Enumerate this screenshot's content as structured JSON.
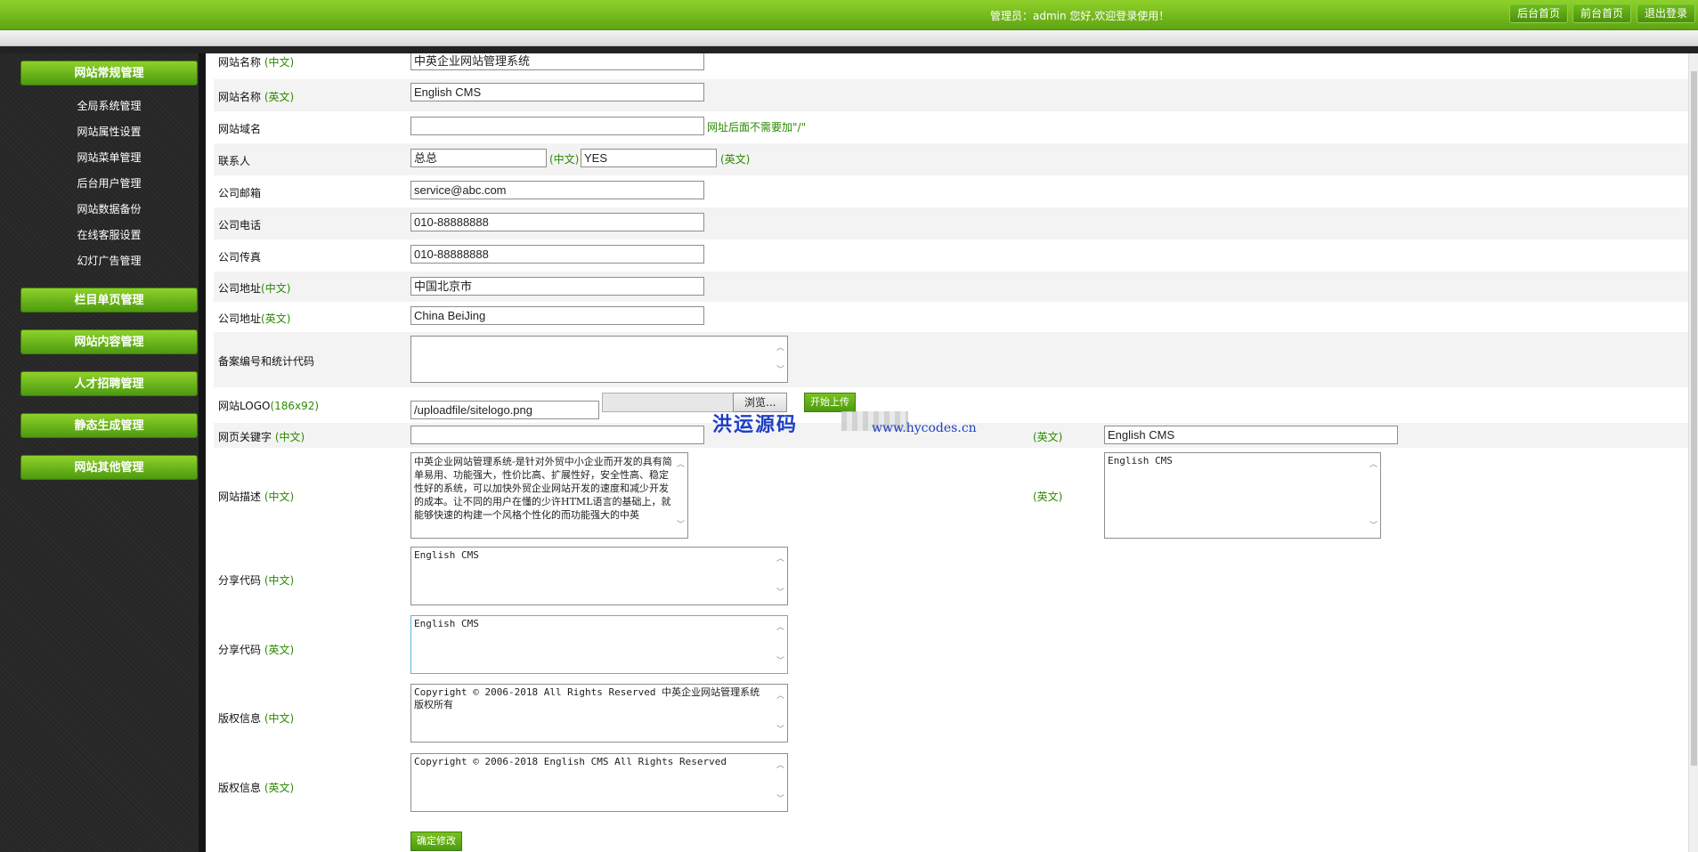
{
  "header": {
    "welcome": "管理员：admin 您好,欢迎登录使用！",
    "buttons": [
      "后台首页",
      "前台首页",
      "退出登录"
    ]
  },
  "sidebar": {
    "groups": [
      {
        "title": "网站常规管理",
        "items": [
          "全局系统管理",
          "网站属性设置",
          "网站菜单管理",
          "后台用户管理",
          "网站数据备份",
          "在线客服设置",
          "幻灯广告管理"
        ]
      },
      {
        "title": "栏目单页管理"
      },
      {
        "title": "网站内容管理"
      },
      {
        "title": "人才招聘管理"
      },
      {
        "title": "静态生成管理"
      },
      {
        "title": "网站其他管理"
      }
    ]
  },
  "form": {
    "cn": "(中文)",
    "en": "(英文)",
    "site_name_label": "网站名称",
    "site_name_cn": "中英企业网站管理系统",
    "site_name_en": "English CMS",
    "domain_label": "网站域名",
    "domain_value": "",
    "domain_note": "网址后面不需要加\"/\"",
    "contact_label": "联系人",
    "contact_cn": "总总",
    "contact_en": "YES",
    "email_label": "公司邮箱",
    "email_value": "service@abc.com",
    "phone_label": "公司电话",
    "phone_value": "010-88888888",
    "fax_label": "公司传真",
    "fax_value": "010-88888888",
    "address_label": "公司地址",
    "address_cn": "中国北京市",
    "address_en": "China BeiJing",
    "icp_label": "备案编号和统计代码",
    "icp_value": "",
    "logo_label": "网站LOGO",
    "logo_size": "(186x92)",
    "logo_path": "/uploadfile/sitelogo.png",
    "browse_label": "浏览...",
    "upload_label": "开始上传",
    "keywords_label": "网页关键字",
    "keywords_cn": "",
    "keywords_en": "English CMS",
    "desc_label": "网站描述",
    "desc_cn": "中英企业网站管理系统-是针对外贸中小企业而开发的具有简单易用、功能强大，性价比高、扩展性好，安全性高、稳定性好的系统，可以加快外贸企业网站开发的速度和减少开发的成本。让不同的用户在懂的少许HTML语言的基础上，就能够快速的构建一个风格个性化的而功能强大的中英",
    "desc_en": "English CMS",
    "share_label": "分享代码",
    "share_cn": "English CMS",
    "share_en": "English CMS",
    "copyright_label": "版权信息",
    "copyright_cn": "Copyright © 2006-2018 All Rights Reserved 中英企业网站管理系统 版权所有",
    "copyright_en": "Copyright © 2006-2018 English CMS All Rights Reserved",
    "submit_label": "确定修改"
  },
  "watermark": {
    "text": "洪运源码",
    "url": "www.hycodes.cn"
  }
}
